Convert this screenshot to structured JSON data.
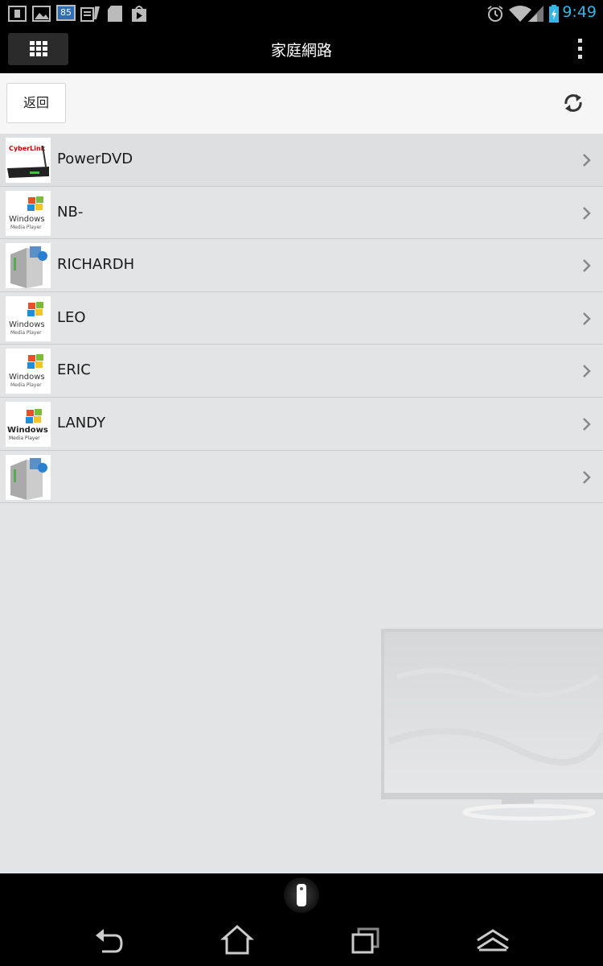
{
  "status_bar": {
    "time": "9:49",
    "notification_badge": "85",
    "notification_icons": [
      "calendar-icon",
      "gallery-icon",
      "badge-85-icon",
      "notes-icon",
      "sd-card-icon",
      "play-store-icon"
    ],
    "system_icons": [
      "alarm-icon",
      "wifi-icon",
      "signal-icon",
      "battery-charging-icon"
    ]
  },
  "action_bar": {
    "title": "家庭網路",
    "menu_icon": "grid-icon",
    "overflow_icon": "overflow-menu-icon"
  },
  "toolbar": {
    "back_label": "返回",
    "refresh_icon": "refresh-icon"
  },
  "devices": [
    {
      "name": "PowerDVD",
      "icon": "cyberlink-router-icon"
    },
    {
      "name": "NB-",
      "icon": "windows-media-player-icon"
    },
    {
      "name": "RICHARDH",
      "icon": "media-server-icon"
    },
    {
      "name": "LEO",
      "icon": "windows-media-player-icon"
    },
    {
      "name": "ERIC",
      "icon": "windows-media-player-icon"
    },
    {
      "name": "LANDY",
      "icon": "windows-media-player-icon"
    },
    {
      "name": "",
      "icon": "media-server-icon"
    }
  ],
  "thumb_text": {
    "cyberlink": "CyberLink",
    "windows": "Windows",
    "media_player": "Media Player"
  },
  "bottom": {
    "remote_icon": "remote-control-icon",
    "nav_icons": [
      "back-icon",
      "home-icon",
      "recent-apps-icon",
      "menu-up-icon"
    ]
  },
  "colors": {
    "accent_time": "#33b5e5",
    "content_bg": "#e3e4e5"
  }
}
